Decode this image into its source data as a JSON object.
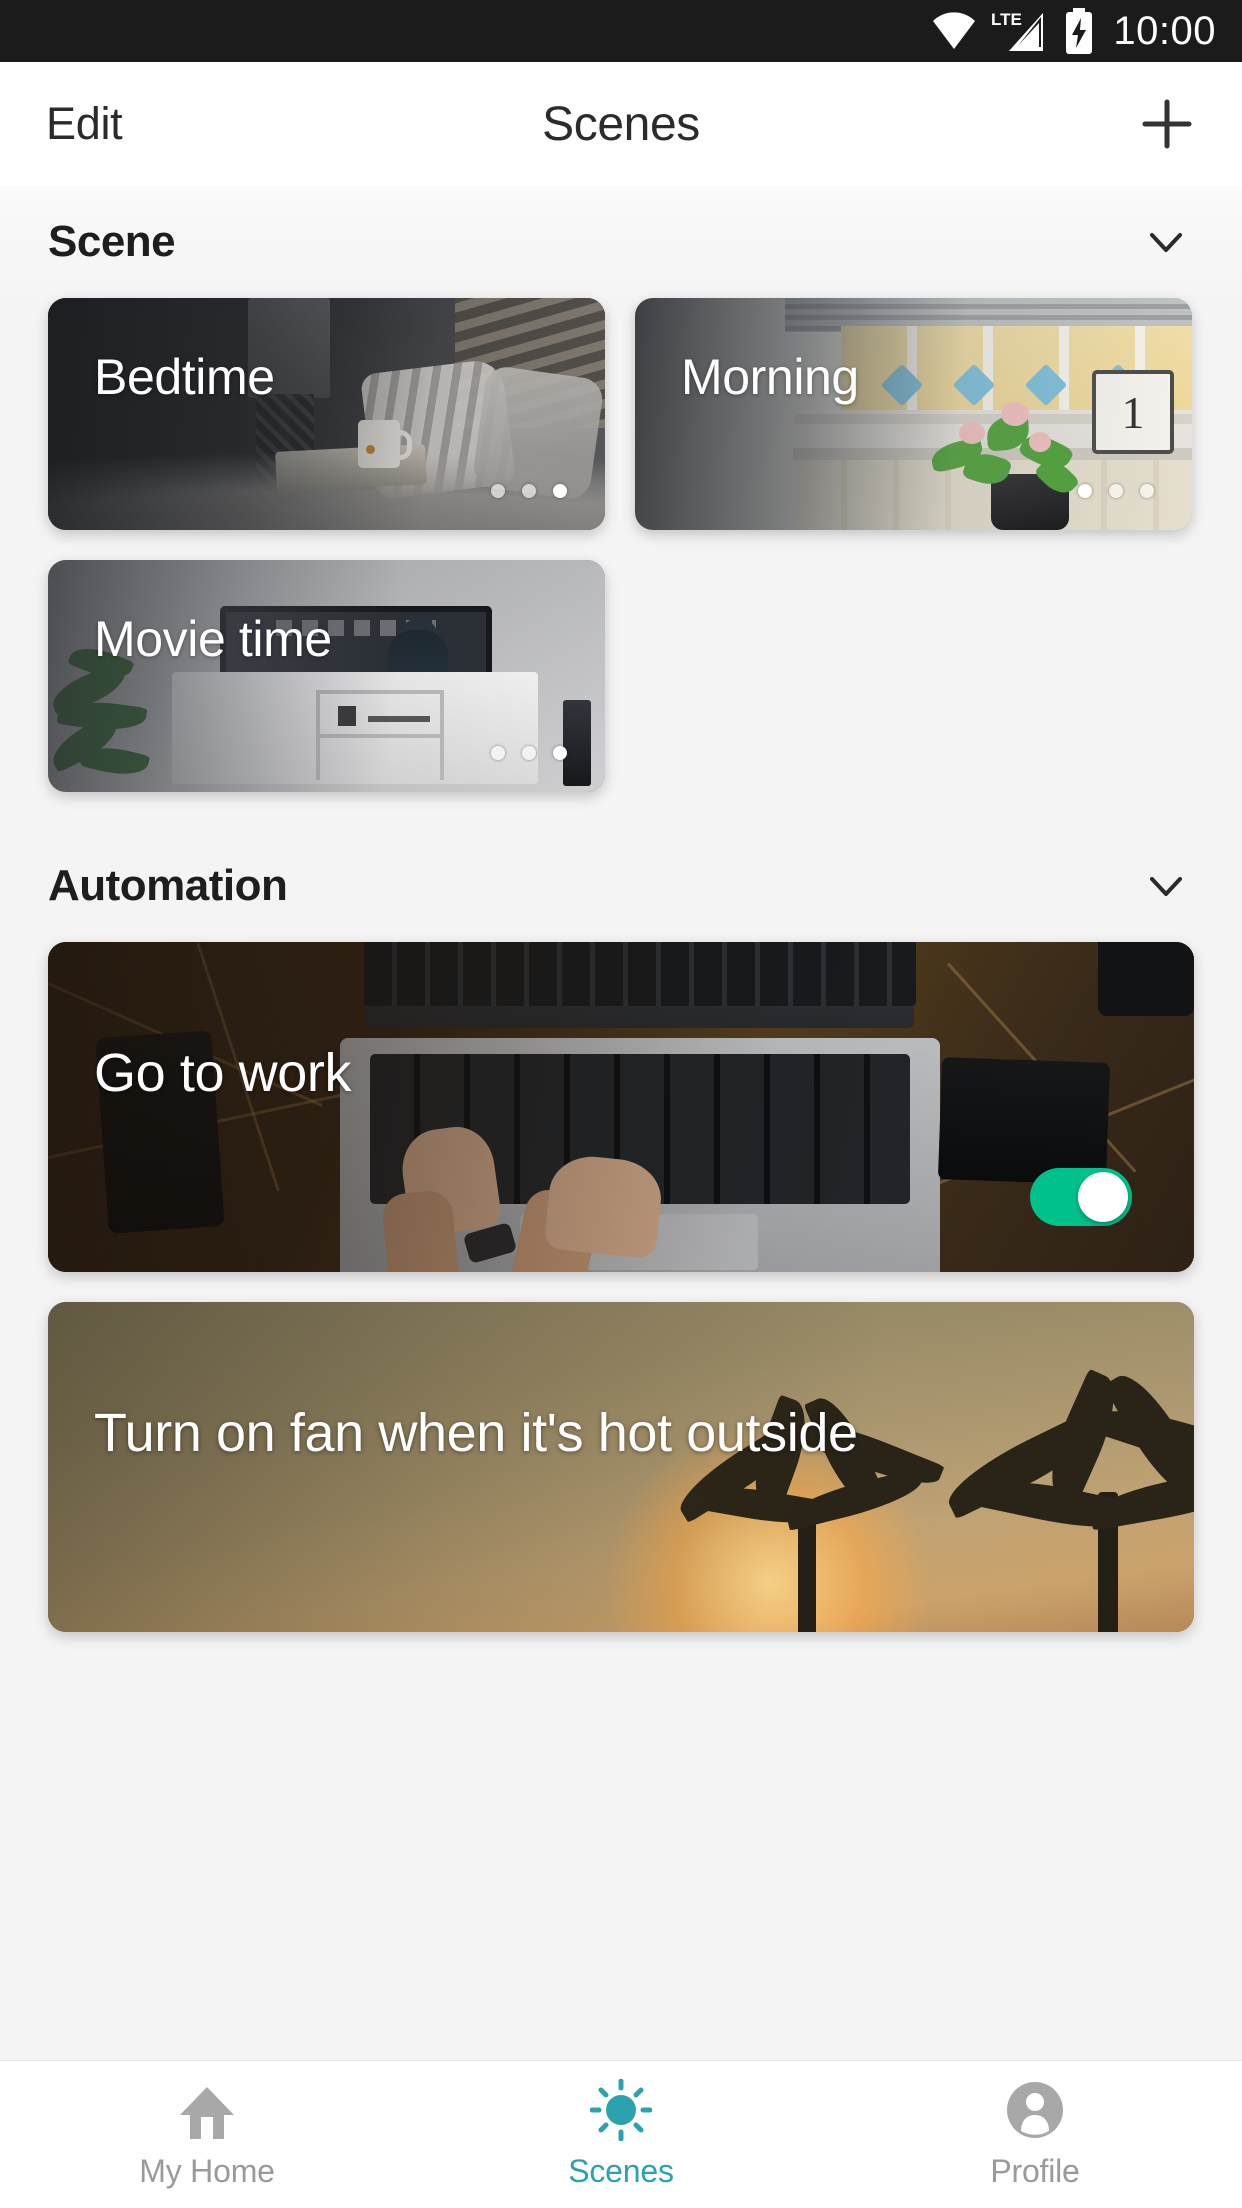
{
  "status_bar": {
    "time": "10:00",
    "network_label": "LTE",
    "icons": [
      "wifi-icon",
      "lte-signal-icon",
      "battery-charging-icon"
    ]
  },
  "header": {
    "edit_label": "Edit",
    "title": "Scenes",
    "add_icon": "plus-icon"
  },
  "sections": [
    {
      "title": "Scene",
      "collapse_icon": "chevron-down-icon"
    },
    {
      "title": "Automation",
      "collapse_icon": "chevron-down-icon"
    }
  ],
  "scenes": [
    {
      "name": "Bedtime",
      "dots": 3,
      "active_dot": 3,
      "artwork": "dark-bedroom-photo"
    },
    {
      "name": "Morning",
      "dots": 3,
      "active_dot": 1,
      "artwork": "bright-kitchen-photo"
    },
    {
      "name": "Movie time",
      "dots": 3,
      "active_dot": 3,
      "artwork": "living-room-tv-photo"
    }
  ],
  "automations": [
    {
      "name": "Go to work",
      "artwork": "laptop-desk-photo",
      "toggle": {
        "state": "on",
        "accent": "#00C08B"
      }
    },
    {
      "name": "Turn on fan when it's hot outside",
      "artwork": "palm-sunset-photo",
      "toggle": null
    }
  ],
  "bottom_nav": {
    "active": "Scenes",
    "accent": "#2BA3AF",
    "inactive_color": "#9A9A9A",
    "items": [
      {
        "label": "My Home",
        "icon": "home-icon",
        "active": false
      },
      {
        "label": "Scenes",
        "icon": "sun-icon",
        "active": true
      },
      {
        "label": "Profile",
        "icon": "person-icon",
        "active": false
      }
    ]
  }
}
